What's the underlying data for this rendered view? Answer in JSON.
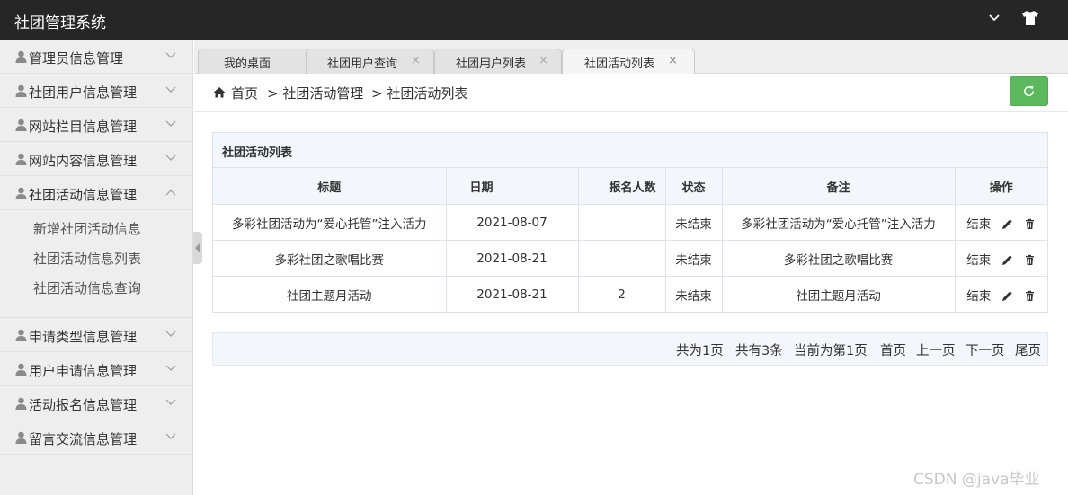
{
  "app": {
    "title": "社团管理系统"
  },
  "header": {
    "chevron_icon": "chevron-down-icon",
    "skin_icon": "tshirt-icon"
  },
  "sidebar": {
    "groups_before": [
      {
        "label": "管理员信息管理"
      },
      {
        "label": "社团用户信息管理"
      },
      {
        "label": "网站栏目信息管理"
      },
      {
        "label": "网站内容信息管理"
      }
    ],
    "expanded": {
      "label": "社团活动信息管理",
      "items": [
        "新增社团活动信息",
        "社团活动信息列表",
        "社团活动信息查询"
      ]
    },
    "groups_after": [
      {
        "label": "申请类型信息管理"
      },
      {
        "label": "用户申请信息管理"
      },
      {
        "label": "活动报名信息管理"
      },
      {
        "label": "留言交流信息管理"
      }
    ]
  },
  "tabs": [
    {
      "label": "我的桌面",
      "closable": false
    },
    {
      "label": "社团用户查询",
      "closable": true
    },
    {
      "label": "社团用户列表",
      "closable": true
    },
    {
      "label": "社团活动列表",
      "closable": true,
      "active": true
    }
  ],
  "tab_close_glyph": "×",
  "breadcrumb": {
    "home": "首页",
    "level1": "> 社团活动管理",
    "level2": "> 社团活动列表"
  },
  "panel": {
    "title": "社团活动列表"
  },
  "table": {
    "headers": [
      "标题",
      "日期",
      "报名人数",
      "状态",
      "备注",
      "操作"
    ],
    "rows": [
      {
        "title": "多彩社团活动为“爱心托管”注入活力",
        "date": "2021-08-07",
        "count": "",
        "status": "未结束",
        "note": "多彩社团活动为“爱心托管”注入活力",
        "action": "结束"
      },
      {
        "title": "多彩社团之歌唱比赛",
        "date": "2021-08-21",
        "count": "",
        "status": "未结束",
        "note": "多彩社团之歌唱比赛",
        "action": "结束"
      },
      {
        "title": "社团主题月活动",
        "date": "2021-08-21",
        "count": "2",
        "status": "未结束",
        "note": "社团主题月活动",
        "action": "结束"
      }
    ]
  },
  "pager": {
    "total_pages": "共为1页",
    "total_records": "共有3条",
    "current": "当前为第1页",
    "first": "首页",
    "prev": "上一页",
    "next": "下一页",
    "last": "尾页"
  },
  "watermark": "CSDN @java毕业",
  "colors": {
    "topbar": "#262626",
    "refresh_button": "#5cb85c",
    "sidebar": "#eeeeee",
    "table_header": "#f3f6fb"
  }
}
